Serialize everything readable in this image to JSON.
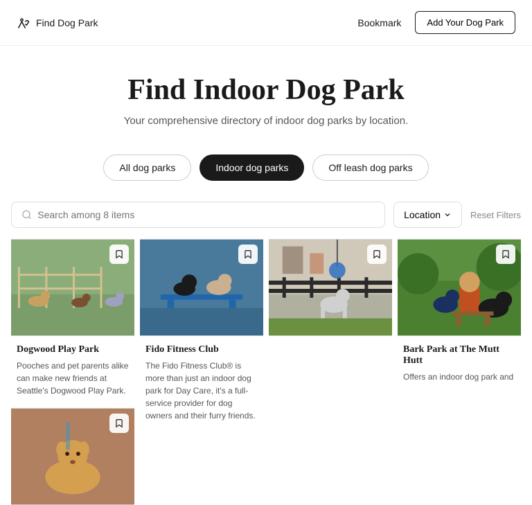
{
  "nav": {
    "logo_text": "Find Dog Park",
    "bookmark_label": "Bookmark",
    "add_btn_label": "Add Your Dog Park"
  },
  "hero": {
    "title": "Find Indoor Dog Park",
    "subtitle": "Your comprehensive directory of indoor dog parks by location."
  },
  "filters": {
    "tabs": [
      {
        "label": "All dog parks",
        "active": false
      },
      {
        "label": "Indoor dog parks",
        "active": true
      },
      {
        "label": "Off leash dog parks",
        "active": false
      }
    ]
  },
  "search": {
    "placeholder": "Search among 8 items",
    "location_label": "Location",
    "reset_label": "Reset Filters"
  },
  "cards": [
    {
      "title": "Dogwood Play Park",
      "desc": "Pooches and pet parents alike can make new friends at Seattle's Dogwood Play Park.",
      "img_color": "#8aad7a",
      "img_color2": "#c5dba8",
      "row": 0,
      "col": 0
    },
    {
      "title": "Fido Fitness Club",
      "desc": "The Fido Fitness Club® is more than just an indoor dog park for Day Care, it's a full-service provider for dog owners and their furry friends.",
      "img_color": "#5588b0",
      "img_color2": "#88bbd0",
      "row": 0,
      "col": 1
    },
    {
      "title": "",
      "desc": "",
      "img_color": "#b08060",
      "img_color2": "#d0b090",
      "row": 0,
      "col": 2
    },
    {
      "title": "Bark Park at The Mutt Hutt",
      "desc": "Offers an indoor dog park and",
      "img_color": "#5a9040",
      "img_color2": "#90c060",
      "row": 0,
      "col": 3
    },
    {
      "title": "",
      "desc": "",
      "img_color": "#c08850",
      "img_color2": "#e0b870",
      "row": 1,
      "col": 0
    }
  ]
}
